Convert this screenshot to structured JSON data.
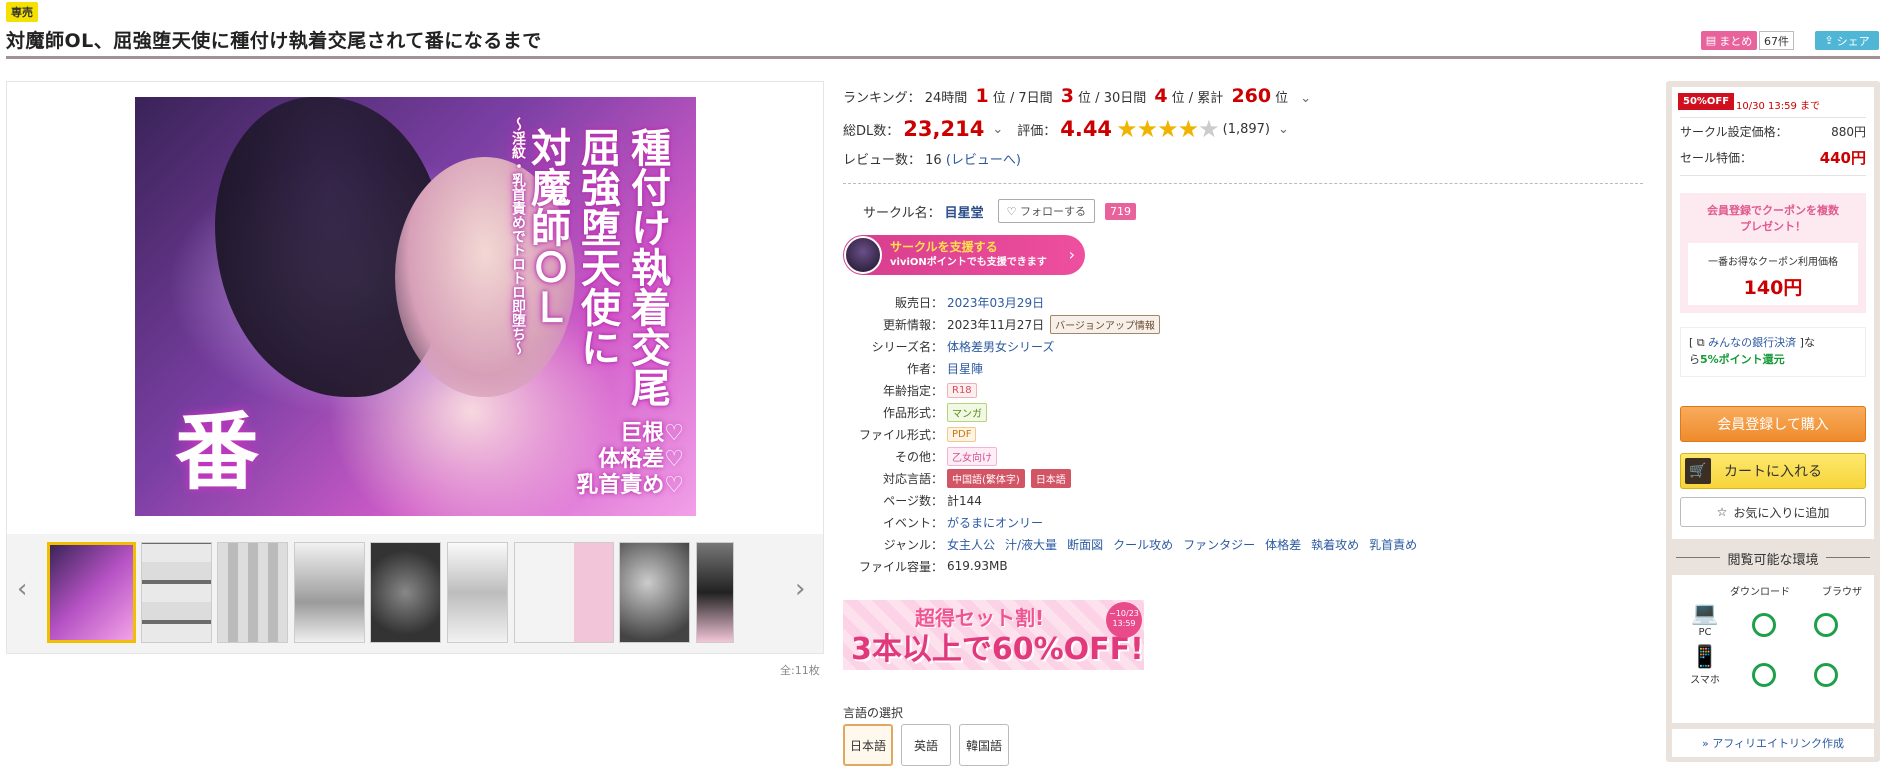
{
  "header": {
    "exclusive_badge": "専売",
    "title": "対魔師OL、屈強堕天使に種付け執着交尾されて番になるまで",
    "matome_label": "まとめ",
    "matome_count": "67件",
    "share_label": "シェア"
  },
  "gallery": {
    "cover_text": {
      "small": "〜淫紋・乳首責めでトロトロ即堕ち〜",
      "line1": "対魔師ＯＬ",
      "line2": "屈強堕天使に",
      "line3": "種付け執着交尾",
      "big": "番",
      "sub": [
        "巨根♡",
        "体格差♡",
        "乳首責め♡"
      ]
    },
    "image_count": "全:11枚"
  },
  "info": {
    "ranking_label": "ランキング：",
    "rank_24h_label": "24時間",
    "rank_24h": "1",
    "rank_7d_label": "7日間",
    "rank_7d": "3",
    "rank_30d_label": "30日間",
    "rank_30d": "4",
    "rank_total_label": "累計",
    "rank_total": "260",
    "rank_unit": "位",
    "downloads_label": "総DL数：",
    "downloads": "23,214",
    "rating_label": "評価：",
    "rating": "4.44",
    "rating_count": "(1,897)",
    "review_label": "レビュー数：",
    "review_count": "16",
    "review_link": "(レビューへ)",
    "circle_label": "サークル名：",
    "circle_name": "目星堂",
    "follow_label": "フォローする",
    "follower_count": "719",
    "support_line1": "サークルを支援する",
    "support_line2": "viviONポイントでも支援できます",
    "details": {
      "release_label": "販売日：",
      "release": "2023年03月29日",
      "update_label": "更新情報：",
      "update": "2023年11月27日",
      "update_tag": "バージョンアップ情報",
      "series_label": "シリーズ名：",
      "series": "体格差男女シリーズ",
      "author_label": "作者：",
      "author": "目星陣",
      "age_label": "年齢指定：",
      "age": "R18",
      "format_label": "作品形式：",
      "format": "マンガ",
      "file_label": "ファイル形式：",
      "file": "PDF",
      "other_label": "その他：",
      "other": "乙女向け",
      "lang_label": "対応言語：",
      "lang1": "中国語(繁体字)",
      "lang2": "日本語",
      "pages_label": "ページ数：",
      "pages": "計144",
      "event_label": "イベント：",
      "event": "がるまにオンリー",
      "genre_label": "ジャンル：",
      "genres": [
        "女主人公",
        "汁/液大量",
        "断面図",
        "クール攻め",
        "ファンタジー",
        "体格差",
        "執着攻め",
        "乳首責め"
      ],
      "size_label": "ファイル容量：",
      "size": "619.93MB"
    },
    "promo": {
      "top": "超得セット割!",
      "main": "3本以上で60%OFF!",
      "date1": "~10/23",
      "date2": "13:59"
    },
    "lang_select_label": "言語の選択",
    "lang_options": [
      "日本語",
      "英語",
      "韓国語"
    ]
  },
  "side": {
    "sale_badge": "50%OFF",
    "sale_until": "10/30 13:59 まで",
    "circle_price_label": "サークル設定価格：",
    "circle_price": "880円",
    "sale_price_label": "セール特価：",
    "sale_price": "440円",
    "coupon_head1": "会員登録でクーポンを複数",
    "coupon_head2": "プレゼント！",
    "coupon_inner_label": "一番お得なクーポン利用価格",
    "coupon_price": "140円",
    "bank_link": "みんなの銀行決済",
    "bank_pre": "[",
    "bank_post": "]な",
    "bank_line2a": "ら",
    "bank_green": "5%ポイント還元",
    "buy_label": "会員登録して購入",
    "cart_label": "カートに入れる",
    "fav_label": "お気に入りに追加",
    "env_title": "閲覧可能な環境",
    "env_col_download": "ダウンロード",
    "env_col_browser": "ブラウザ",
    "env_pc": "PC",
    "env_phone": "スマホ",
    "affiliate": "» アフィリエイトリンク作成"
  },
  "colors": {
    "accent_red": "#c00000",
    "pink": "#e8639b",
    "share_blue": "#4fb6d6",
    "link_blue": "#2c5aa0",
    "ok_green": "#1da04a"
  }
}
